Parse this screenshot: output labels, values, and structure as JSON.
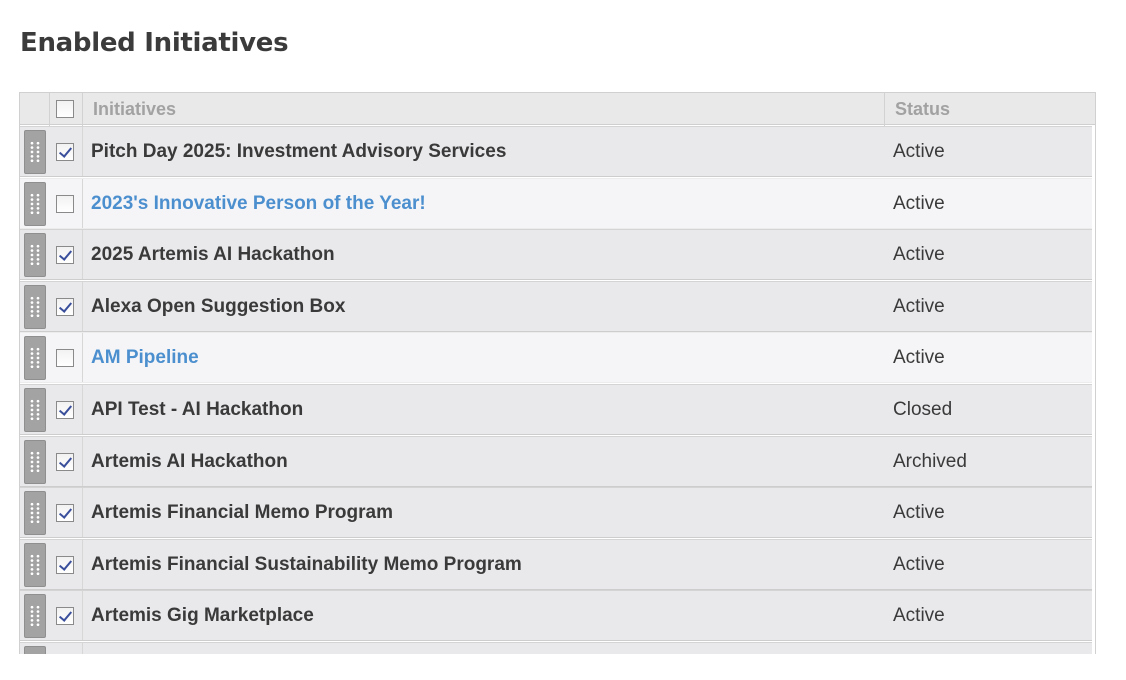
{
  "page": {
    "title": "Enabled Initiatives"
  },
  "table": {
    "headers": {
      "initiatives": "Initiatives",
      "status": "Status"
    },
    "rows": [
      {
        "name": "Pitch Day 2025: Investment Advisory Services",
        "status": "Active",
        "checked": true,
        "link": false
      },
      {
        "name": "2023's Innovative Person of the Year!",
        "status": "Active",
        "checked": false,
        "link": true
      },
      {
        "name": "2025 Artemis AI Hackathon",
        "status": "Active",
        "checked": true,
        "link": false
      },
      {
        "name": "Alexa Open Suggestion Box",
        "status": "Active",
        "checked": true,
        "link": false
      },
      {
        "name": "AM Pipeline",
        "status": "Active",
        "checked": false,
        "link": true
      },
      {
        "name": "API Test - AI Hackathon",
        "status": "Closed",
        "checked": true,
        "link": false
      },
      {
        "name": "Artemis AI Hackathon",
        "status": "Archived",
        "checked": true,
        "link": false
      },
      {
        "name": "Artemis Financial Memo Program",
        "status": "Active",
        "checked": true,
        "link": false
      },
      {
        "name": "Artemis Financial Sustainability Memo Program",
        "status": "Active",
        "checked": true,
        "link": false
      },
      {
        "name": "Artemis Gig Marketplace",
        "status": "Active",
        "checked": true,
        "link": false
      },
      {
        "name": "",
        "status": "",
        "checked": false,
        "link": false
      }
    ]
  },
  "icons": {
    "drag": "drag-handle-icon",
    "checkbox": "checkbox-icon"
  },
  "colors": {
    "link": "#4c8fcf",
    "text": "#3a3a3a",
    "header_bg": "#e9e9e9",
    "row_bg": "#e9e9ec",
    "row_bg_unchecked": "#f5f5f7",
    "handle": "#a3a3a3"
  }
}
